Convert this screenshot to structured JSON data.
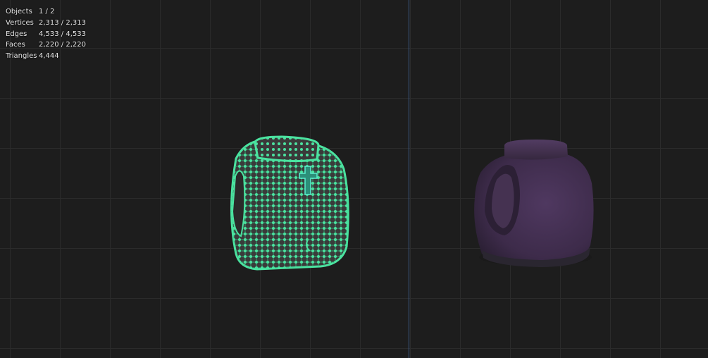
{
  "stats": {
    "objects": {
      "label": "Objects",
      "value": "1 / 2"
    },
    "vertices": {
      "label": "Vertices",
      "value": "2,313 / 2,313"
    },
    "edges": {
      "label": "Edges",
      "value": "4,533 / 4,533"
    },
    "faces": {
      "label": "Faces",
      "value": "2,220 / 2,220"
    },
    "triangles": {
      "label": "Triangles",
      "value": "4,444"
    }
  },
  "colors": {
    "background": "#1d1d1d",
    "grid": "#2b2b2b",
    "y_axis": "#3d5a86",
    "wire_selected": "#4be3a0",
    "mesh_face": "#3a3a3a",
    "solid_object": "#3e2b48"
  },
  "objects": [
    {
      "name": "jar-mesh-edit-mode",
      "state": "selected-wireframe"
    },
    {
      "name": "jar-solid",
      "state": "solid-shaded"
    }
  ]
}
